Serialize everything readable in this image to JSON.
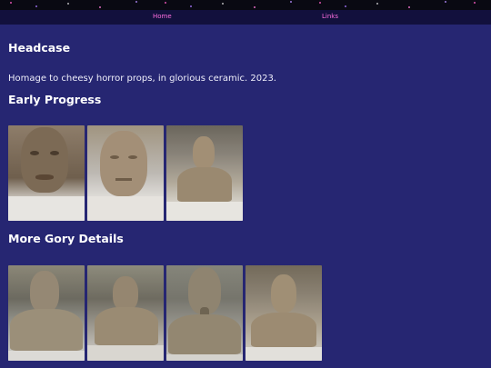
{
  "nav": {
    "home_label": "Home",
    "links_label": "Links"
  },
  "page": {
    "title": "Headcase",
    "description": "Homage to cheesy horror props, in glorious ceramic. 2023."
  },
  "sections": {
    "early": {
      "heading": "Early Progress"
    },
    "gory": {
      "heading": "More Gory Details"
    }
  }
}
